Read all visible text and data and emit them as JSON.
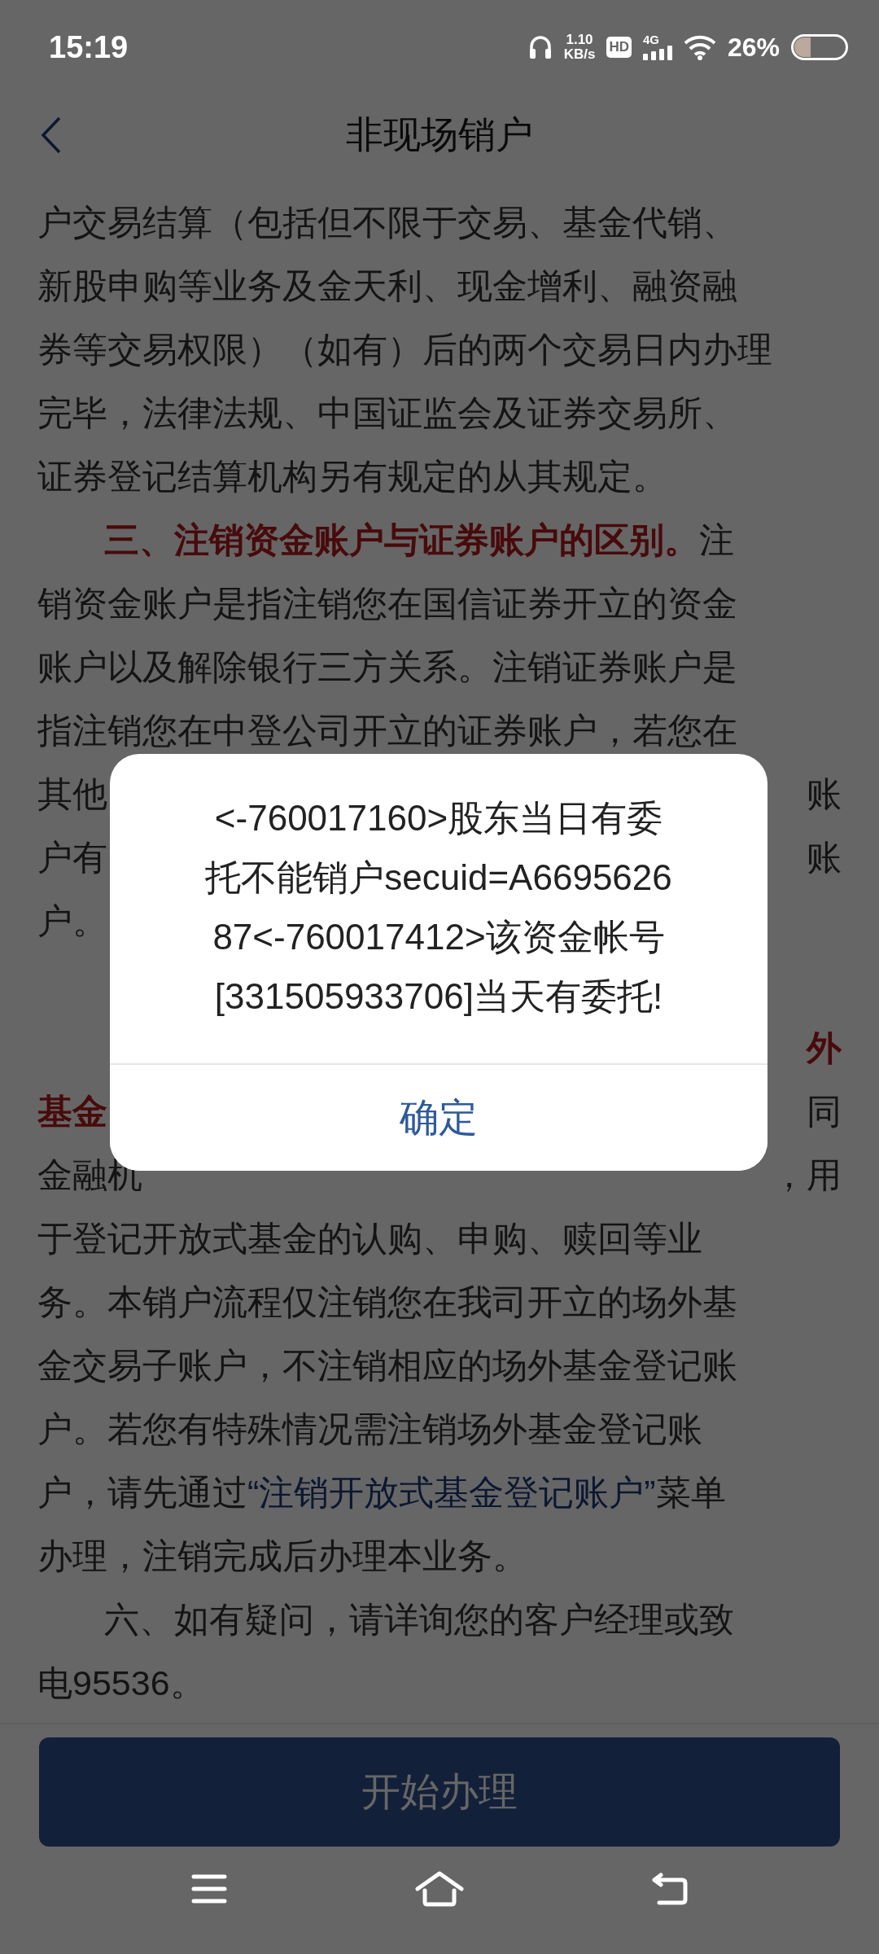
{
  "status_bar": {
    "time": "15:19",
    "net_speed": "1.10",
    "net_unit": "KB/s",
    "hd": "HD",
    "network": "4G",
    "battery": "26%"
  },
  "header": {
    "title": "非现场销户"
  },
  "body_lines": [
    {
      "indent": false,
      "left": [
        {
          "kind": "normal",
          "text": "户交易结算（包括但不限于交易、基金代销、"
        }
      ]
    },
    {
      "indent": false,
      "left": [
        {
          "kind": "normal",
          "text": "新股申购等业务及金天利、现金增利、融资融"
        }
      ]
    },
    {
      "indent": false,
      "left": [
        {
          "kind": "normal",
          "text": "券等交易权限）（如有）后的两个交易日内办理"
        }
      ]
    },
    {
      "indent": false,
      "left": [
        {
          "kind": "normal",
          "text": "完毕，法律法规、中国证监会及证券交易所、"
        }
      ]
    },
    {
      "indent": false,
      "left": [
        {
          "kind": "normal",
          "text": "证券登记结算机构另有规定的从其规定。"
        }
      ]
    },
    {
      "indent": true,
      "left": [
        {
          "kind": "red",
          "text": "三、注销资金账户与证券账户的区别。"
        },
        {
          "kind": "normal",
          "text": "注"
        }
      ]
    },
    {
      "indent": false,
      "left": [
        {
          "kind": "normal",
          "text": "销资金账户是指注销您在国信证券开立的资金"
        }
      ]
    },
    {
      "indent": false,
      "left": [
        {
          "kind": "normal",
          "text": "账户以及解除银行三方关系。注销证券账户是"
        }
      ]
    },
    {
      "indent": false,
      "left": [
        {
          "kind": "normal",
          "text": "指注销您在中登公司开立的证券账户，若您在"
        }
      ]
    },
    {
      "indent": false,
      "left": [
        {
          "kind": "normal",
          "text": "其他"
        }
      ],
      "right": [
        {
          "kind": "normal",
          "text": "账"
        }
      ]
    },
    {
      "indent": false,
      "left": [
        {
          "kind": "normal",
          "text": "户有"
        }
      ],
      "right": [
        {
          "kind": "normal",
          "text": "账"
        }
      ]
    },
    {
      "indent": false,
      "left": [
        {
          "kind": "normal",
          "text": "户。"
        }
      ]
    },
    {
      "right": [
        {
          "kind": "red",
          "text": "外"
        }
      ]
    },
    {
      "indent": false,
      "left": [
        {
          "kind": "red",
          "text": "基金"
        }
      ],
      "right": [
        {
          "kind": "normal",
          "text": "同"
        }
      ]
    },
    {
      "indent": false,
      "left": [
        {
          "kind": "normal",
          "text": "金融机"
        }
      ],
      "right": [
        {
          "kind": "normal",
          "text": "，用"
        }
      ]
    },
    {
      "indent": false,
      "left": [
        {
          "kind": "normal",
          "text": "于登记开放式基金的认购、申购、赎回等业"
        }
      ]
    },
    {
      "indent": false,
      "left": [
        {
          "kind": "normal",
          "text": "务。本销户流程仅注销您在我司开立的场外基"
        }
      ]
    },
    {
      "indent": false,
      "left": [
        {
          "kind": "normal",
          "text": "金交易子账户，不注销相应的场外基金登记账"
        }
      ]
    },
    {
      "indent": false,
      "left": [
        {
          "kind": "normal",
          "text": "户。若您有特殊情况需注销场外基金登记账"
        }
      ]
    },
    {
      "indent": false,
      "left": [
        {
          "kind": "normal",
          "text": "户，请先通过"
        },
        {
          "kind": "link",
          "text": "“注销开放式基金登记账户”"
        },
        {
          "kind": "normal",
          "text": "菜单"
        }
      ]
    },
    {
      "indent": false,
      "left": [
        {
          "kind": "normal",
          "text": "办理，注销完成后办理本业务。"
        }
      ]
    },
    {
      "indent": true,
      "left": [
        {
          "kind": "normal",
          "text": "六、如有疑问，请详询您的客户经理或致"
        }
      ]
    },
    {
      "indent": false,
      "left": [
        {
          "kind": "normal",
          "text": "电95536。"
        }
      ]
    }
  ],
  "dialog": {
    "message": "<-760017160>股东当日有委托不能销户secuid=A669562687<-760017412>该资金帐号[331505933706]当天有委托!",
    "button": "确定"
  },
  "action_button": {
    "label": "开始办理"
  }
}
